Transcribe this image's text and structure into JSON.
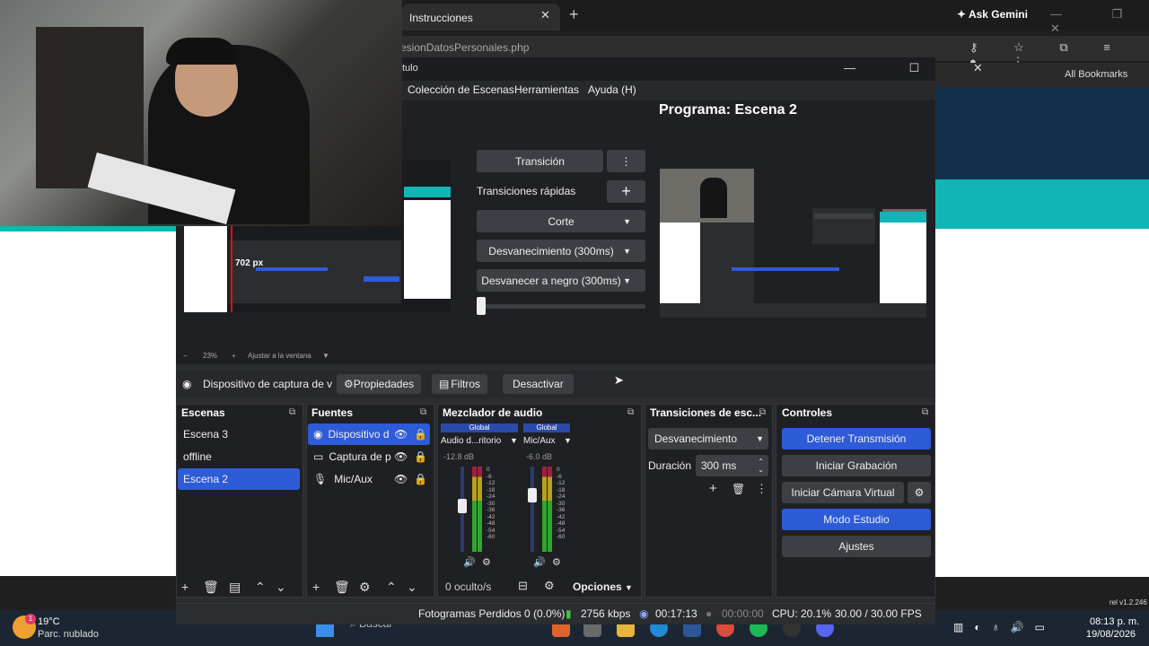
{
  "browser": {
    "tab_title": "Instrucciones",
    "tab_close": "✕",
    "new_tab": "+",
    "gemini": "✦ Ask Gemini",
    "window_controls": "— ❐ ✕",
    "url": "esionDatosPersonales.php",
    "addr_icons": "⚷ ☆ ⧉ ≡ ● ⋮",
    "bookmarks": "All Bookmarks"
  },
  "obs": {
    "title": "tulo",
    "window_controls": "— ☐ ✕",
    "menu": [
      "Colección de Escenas",
      "Herramientas",
      "Ayuda (H)"
    ],
    "preview_zoom": "23%",
    "preview_fit": "Ajustar a la ventana",
    "preview_overlay": "702 px",
    "transition": {
      "transition_button": "Transición",
      "more": "⋮",
      "quick_label": "Transiciones rápidas",
      "add": "+",
      "cut": "Corte",
      "fade": "Desvanecimiento (300ms)",
      "fade_black": "Desvanecer a negro (300ms)"
    },
    "program_label": "Programa: Escena 2",
    "source_toolbar": {
      "device": "Dispositivo de captura de v",
      "properties": "Propiedades",
      "filters": "Filtros",
      "deactivate": "Desactivar"
    },
    "scenes": {
      "title": "Escenas",
      "items": [
        "Escena 3",
        "offline",
        "Escena 2"
      ],
      "selected": "Escena 2"
    },
    "sources": {
      "title": "Fuentes",
      "items": [
        "Dispositivo d",
        "Captura de p",
        "Mic/Aux"
      ]
    },
    "mixer": {
      "title": "Mezclador de audio",
      "channels": [
        {
          "badge": "Global",
          "name": "Audio d...ritorio",
          "db": "-12.8 dB",
          "level": 0.55
        },
        {
          "badge": "Global",
          "name": "Mic/Aux",
          "db": "-6.0 dB",
          "level": 0.7
        }
      ],
      "ticks": [
        "0",
        "-6",
        "-12",
        "-18",
        "-24",
        "-30",
        "-36",
        "-42",
        "-48",
        "-54",
        "-60"
      ],
      "hidden": "0 oculto/s",
      "options": "Opciones"
    },
    "scene_transitions": {
      "title": "Transiciones de esc...",
      "selected": "Desvanecimiento",
      "duration_label": "Duración",
      "duration_value": "300 ms"
    },
    "controls": {
      "title": "Controles",
      "stop_stream": "Detener Transmisión",
      "start_record": "Iniciar Grabación",
      "virtual_cam": "Iniciar Cámara Virtual",
      "studio_mode": "Modo Estudio",
      "settings": "Ajustes"
    },
    "status": {
      "dropped": "Fotogramas Perdidos 0 (0.0%)",
      "bitrate": "2756 kbps",
      "stream_time": "00:17:13",
      "rec_time": "00:00:00",
      "cpu": "CPU: 20.1%",
      "fps": "30.00 / 30.00 FPS"
    }
  },
  "taskbar": {
    "temp": "19°C",
    "weather": "Parc. nublado",
    "badge": "1",
    "search": "Buscar",
    "time": "08:13 p. m.",
    "date": "19/08/2026",
    "rel": "rel v1.2.246"
  },
  "colors": {
    "accent": "#2e5bd7",
    "teal": "#11b5b5"
  }
}
